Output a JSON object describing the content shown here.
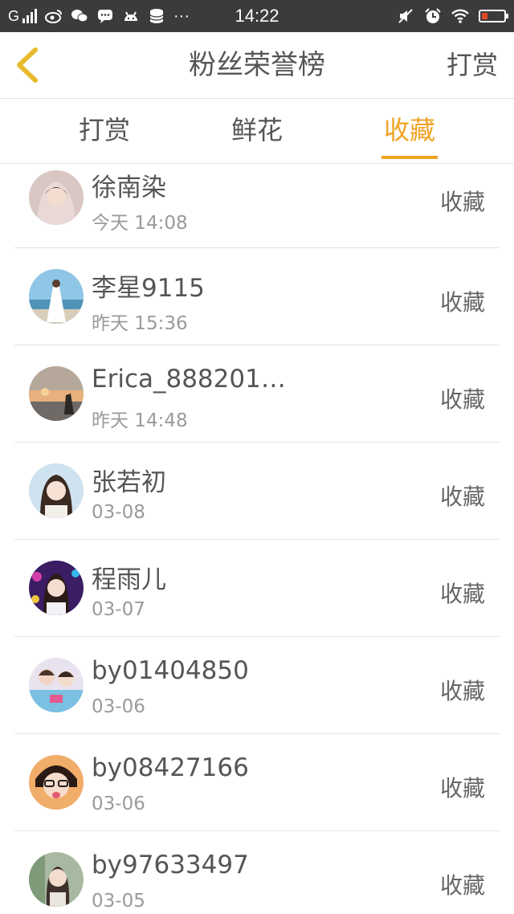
{
  "status_bar": {
    "carrier": "G",
    "time": "14:22",
    "dots": "···",
    "icons": [
      "signal-icon",
      "weibo-icon",
      "wechat-icon",
      "message-icon",
      "android-icon",
      "storage-icon",
      "mute-icon",
      "alarm-icon",
      "wifi-icon",
      "battery-icon"
    ],
    "battery_level": 0.25,
    "battery_color": "#e04a2a"
  },
  "header": {
    "title": "粉丝荣誉榜",
    "action": "打赏",
    "back_icon": "chevron-left-icon",
    "back_icon_color": "#e6ba2c"
  },
  "tabs": [
    {
      "label": "打赏"
    },
    {
      "label": "鲜花"
    },
    {
      "label": "收藏"
    }
  ],
  "active_tab": 2,
  "accent_color": "#f0a324",
  "fans": [
    {
      "name": "徐南染",
      "time": "今天 14:08",
      "type": "收藏"
    },
    {
      "name": "李星9115",
      "time": "昨天 15:36",
      "type": "收藏"
    },
    {
      "name": "Erica_888201…",
      "time": "昨天 14:48",
      "type": "收藏"
    },
    {
      "name": "张若初",
      "time": "03-08",
      "type": "收藏"
    },
    {
      "name": "程雨儿",
      "time": "03-07",
      "type": "收藏"
    },
    {
      "name": "by01404850",
      "time": "03-06",
      "type": "收藏"
    },
    {
      "name": "by08427166",
      "time": "03-06",
      "type": "收藏"
    },
    {
      "name": "by97633497",
      "time": "03-05",
      "type": "收藏"
    }
  ]
}
